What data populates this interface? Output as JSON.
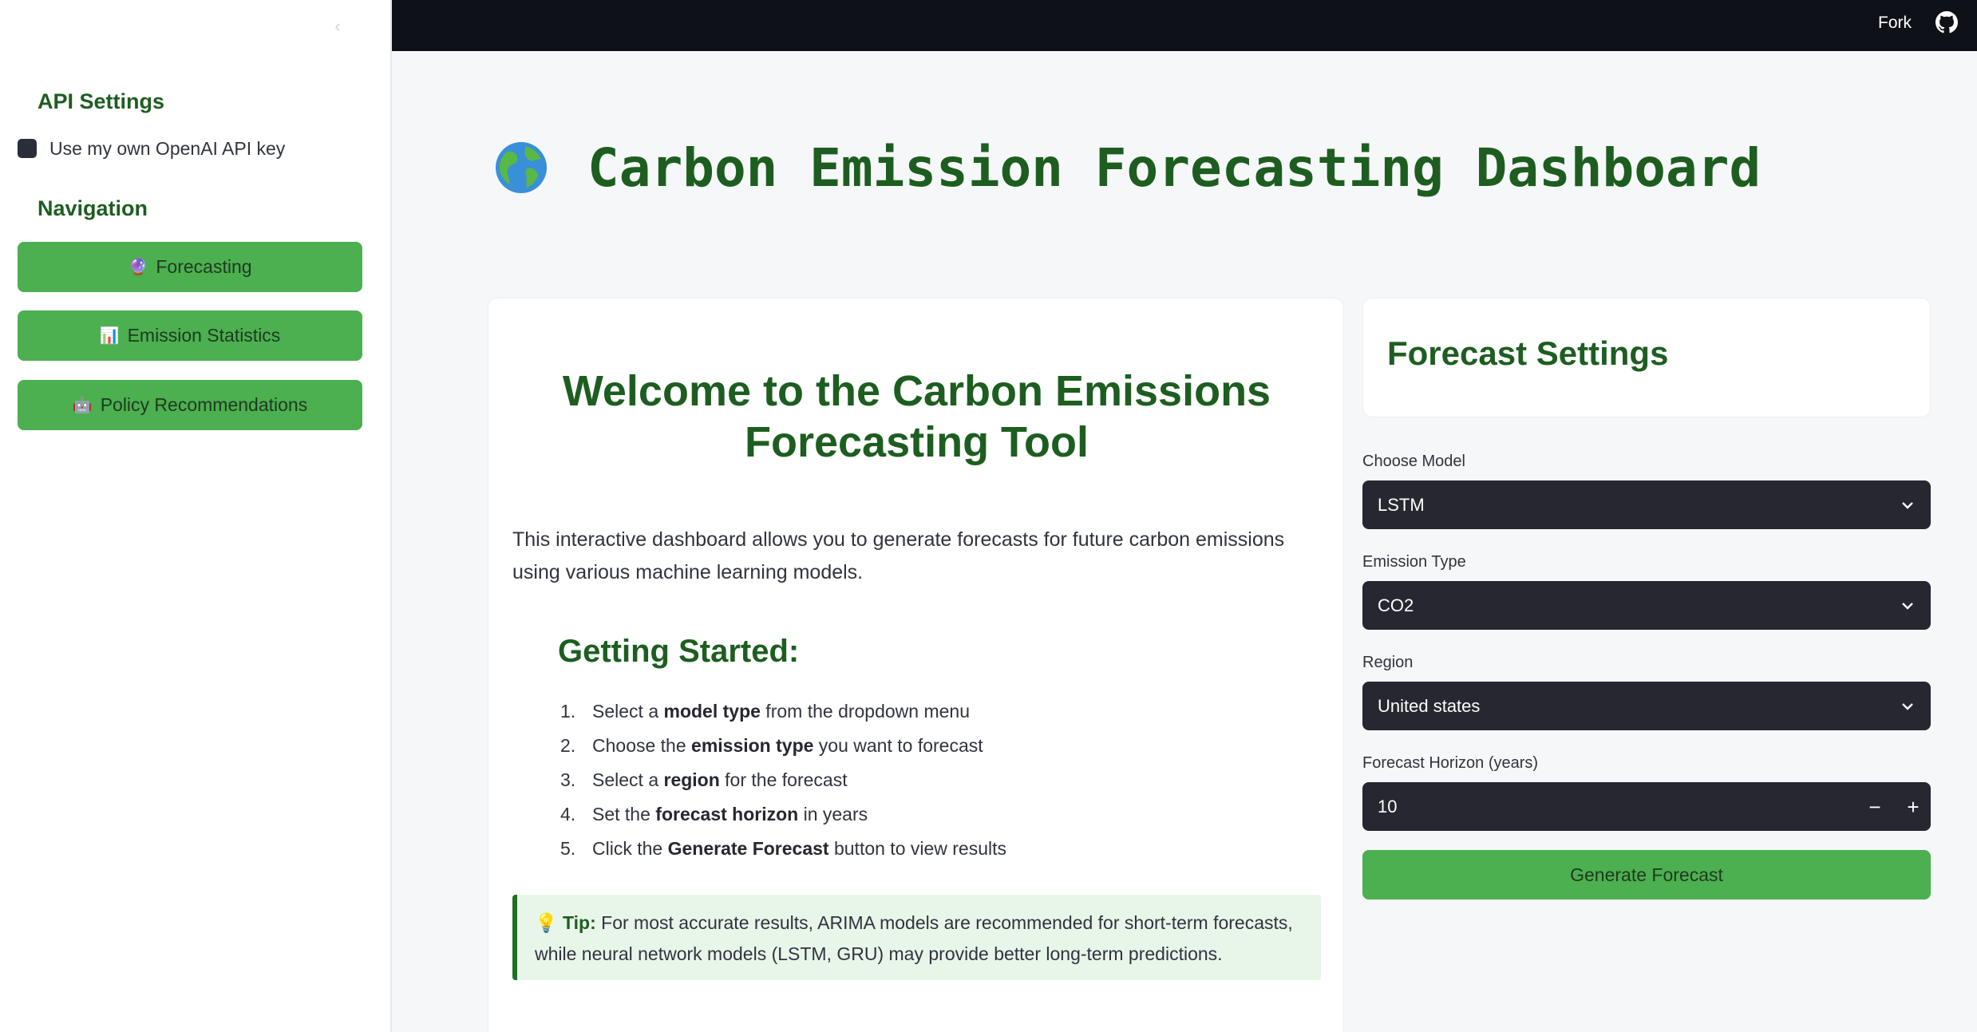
{
  "topbar": {
    "fork_label": "Fork"
  },
  "sidebar": {
    "api_heading": "API Settings",
    "api_checkbox_label": "Use my own OpenAI API key",
    "nav_heading": "Navigation",
    "nav_items": [
      {
        "icon": "🔮",
        "label": "Forecasting"
      },
      {
        "icon": "📊",
        "label": "Emission Statistics"
      },
      {
        "icon": "🤖",
        "label": "Policy Recommendations"
      }
    ]
  },
  "main": {
    "title_icon": "globe-icon",
    "title": "Carbon Emission Forecasting Dashboard",
    "welcome": {
      "title_line1": "Welcome to the Carbon Emissions",
      "title_line2": "Forecasting Tool",
      "intro": "This interactive dashboard allows you to generate forecasts for future carbon emissions using various machine learning models.",
      "getting_started": "Getting Started:",
      "steps": [
        {
          "num": "1.",
          "pre": "Select a ",
          "bold": "model type",
          "post": " from the dropdown menu"
        },
        {
          "num": "2.",
          "pre": "Choose the ",
          "bold": "emission type",
          "post": " you want to forecast"
        },
        {
          "num": "3.",
          "pre": "Select a ",
          "bold": "region",
          "post": " for the forecast"
        },
        {
          "num": "4.",
          "pre": "Set the ",
          "bold": "forecast horizon",
          "post": " in years"
        },
        {
          "num": "5.",
          "pre": "Click the ",
          "bold": "Generate Forecast",
          "post": " button to view results"
        }
      ],
      "tip_icon": "💡",
      "tip_label": "Tip:",
      "tip_text": " For most accurate results, ARIMA models are recommended for short-term forecasts, while neural network models (LSTM, GRU) may provide better long-term predictions."
    }
  },
  "settings": {
    "title": "Forecast Settings",
    "model_label": "Choose Model",
    "model_value": "LSTM",
    "emission_label": "Emission Type",
    "emission_value": "CO2",
    "region_label": "Region",
    "region_value": "United states",
    "horizon_label": "Forecast Horizon (years)",
    "horizon_value": "10",
    "minus": "−",
    "plus": "+",
    "generate_label": "Generate Forecast"
  },
  "colors": {
    "accent_green": "#4caf50",
    "heading_green": "#1d5e20",
    "dark_input": "#262730",
    "topbar": "#0e1117",
    "tip_bg": "#e8f5e9"
  }
}
